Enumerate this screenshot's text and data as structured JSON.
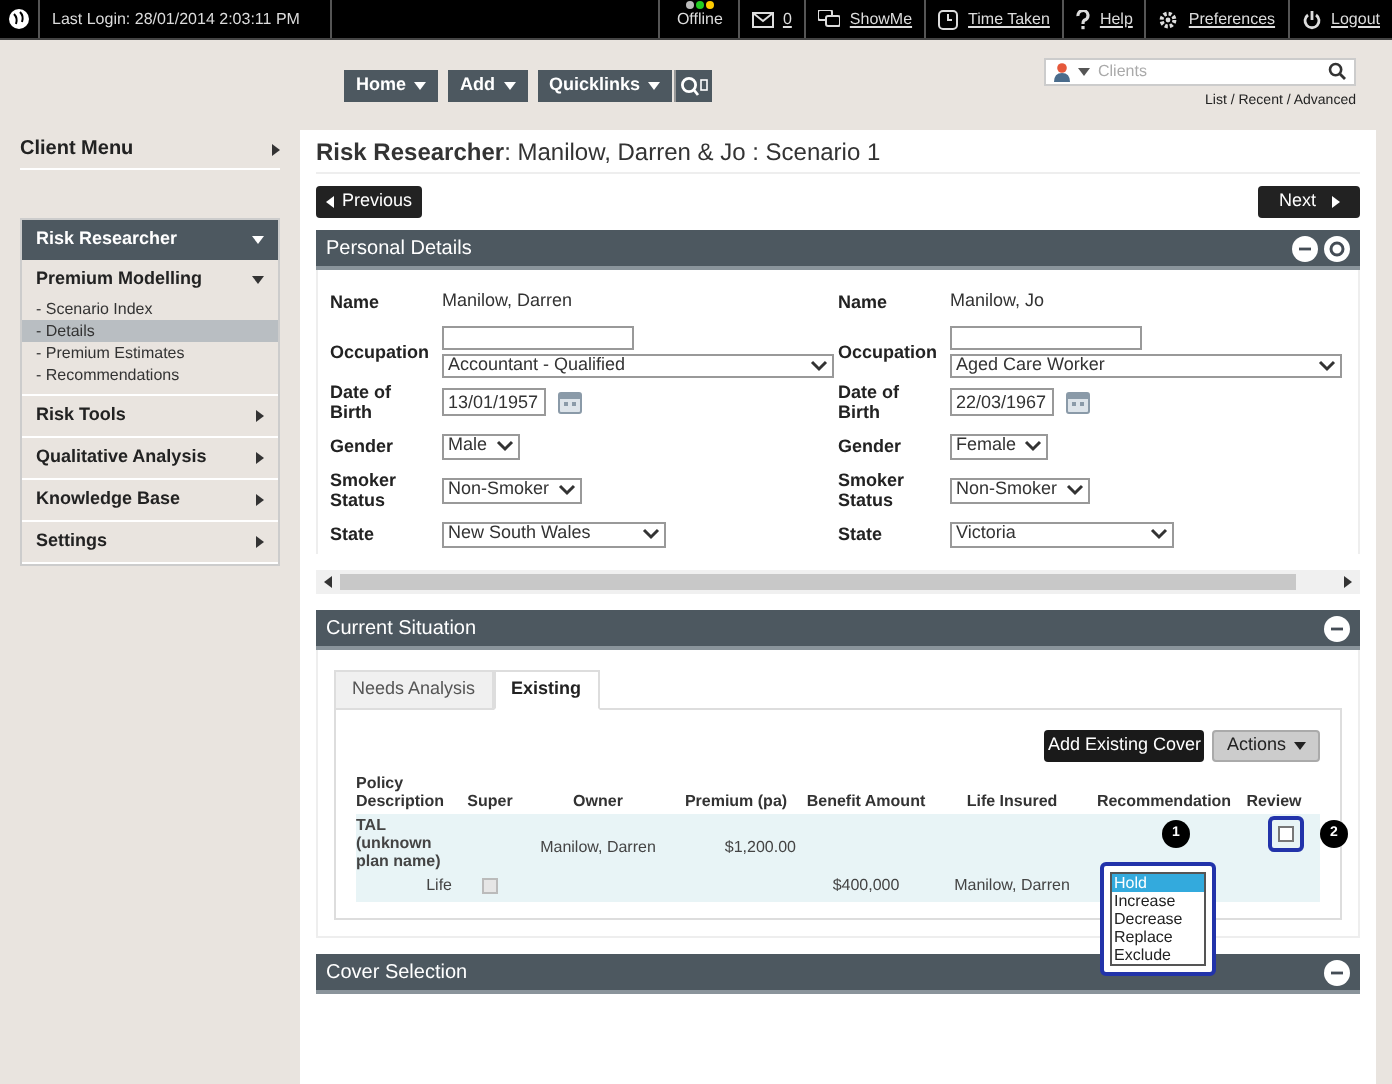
{
  "topbar": {
    "last_login": "Last Login: 28/01/2014 2:03:11 PM",
    "status": "Offline",
    "messages": "0",
    "links": [
      {
        "kind": "showme",
        "label": "ShowMe"
      },
      {
        "kind": "time",
        "label": "Time Taken"
      },
      {
        "kind": "help",
        "label": "Help"
      },
      {
        "kind": "prefs",
        "label": "Preferences"
      },
      {
        "kind": "logout",
        "label": "Logout"
      }
    ]
  },
  "nav": {
    "menus": [
      "Home",
      "Add",
      "Quicklinks"
    ],
    "search": {
      "placeholder": "Clients"
    },
    "search_links": "List / Recent / Advanced"
  },
  "sidebar": {
    "title": "Client Menu",
    "header": "Risk Researcher",
    "groups": [
      {
        "label": "Premium Modelling",
        "expanded": true,
        "children": [
          {
            "label": "- Scenario Index",
            "selected": false
          },
          {
            "label": "- Details",
            "selected": true
          },
          {
            "label": "- Premium Estimates",
            "selected": false
          },
          {
            "label": "- Recommendations",
            "selected": false
          }
        ]
      },
      {
        "label": "Risk Tools",
        "expanded": false
      },
      {
        "label": "Qualitative Analysis",
        "expanded": false
      },
      {
        "label": "Knowledge Base",
        "expanded": false
      },
      {
        "label": "Settings",
        "expanded": false
      }
    ]
  },
  "page_title": "**Risk Researcher**: Manilow, Darren & Jo : Scenario 1",
  "pager": {
    "previous": "Previous",
    "next": "Next"
  },
  "personal_details": {
    "title": "Personal Details",
    "clients": [
      {
        "fields": [
          {
            "kind": "text",
            "label": "Name",
            "value": "Manilow, Darren"
          },
          {
            "kind": "occupation",
            "label": "Occupation",
            "value": "Accountant - Qualified"
          },
          {
            "kind": "date",
            "label": "Date of Birth",
            "value": "13/01/1957"
          },
          {
            "kind": "select",
            "label": "Gender",
            "value": "Male"
          },
          {
            "kind": "select",
            "label": "Smoker Status",
            "value": "Non-Smoker"
          },
          {
            "kind": "wide",
            "label": "State",
            "value": "New South Wales"
          }
        ]
      },
      {
        "fields": [
          {
            "kind": "text",
            "label": "Name",
            "value": "Manilow, Jo"
          },
          {
            "kind": "occupation",
            "label": "Occupation",
            "value": "Aged Care Worker"
          },
          {
            "kind": "date",
            "label": "Date of Birth",
            "value": "22/03/1967"
          },
          {
            "kind": "select",
            "label": "Gender",
            "value": "Female"
          },
          {
            "kind": "select",
            "label": "Smoker Status",
            "value": "Non-Smoker"
          },
          {
            "kind": "wide",
            "label": "State",
            "value": "Victoria"
          }
        ]
      }
    ]
  },
  "current_situation": {
    "title": "Current Situation",
    "tabs": [
      {
        "label": "Needs Analysis",
        "selected": false
      },
      {
        "label": "Existing",
        "selected": true
      }
    ],
    "add_button": "Add Existing Cover",
    "actions_button": "Actions",
    "columns": [
      "Policy Description",
      "Super",
      "Owner",
      "Premium (pa)",
      "Benefit Amount",
      "Life Insured",
      "Recommendation",
      "Review"
    ],
    "policy": {
      "description": "TAL (unknown plan name)",
      "owner": "Manilow, Darren",
      "premium": "$1,200.00",
      "review_checked": false
    },
    "cover": {
      "type": "Life",
      "super_checked": false,
      "benefit": "$400,000",
      "life_insured": "Manilow, Darren",
      "options": [
        {
          "label": "Hold",
          "selected": true
        },
        {
          "label": "Increase",
          "selected": false
        },
        {
          "label": "Decrease",
          "selected": false
        },
        {
          "label": "Replace",
          "selected": false
        },
        {
          "label": "Exclude",
          "selected": false
        }
      ]
    },
    "callouts": [
      "1",
      "2"
    ]
  },
  "cover_selection": {
    "title": "Cover Selection"
  }
}
